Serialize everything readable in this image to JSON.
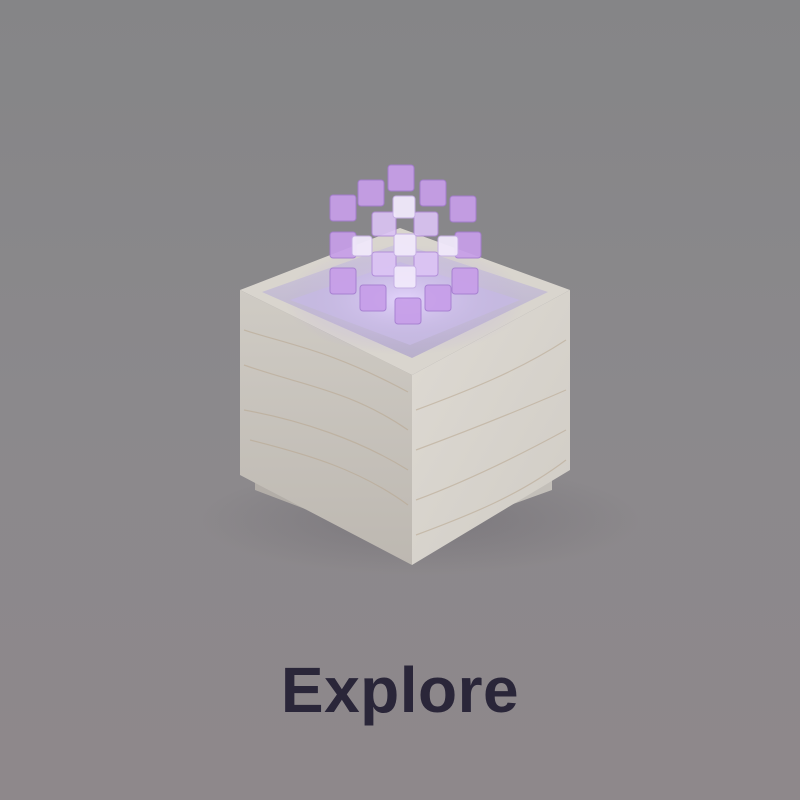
{
  "screen": {
    "label": "Explore",
    "colors": {
      "background_top": "#858587",
      "background_bottom": "#8e888b",
      "label_text": "#2a2639",
      "crystal_accent": "#c8a0ee",
      "box_face": "#d0cdc7"
    }
  },
  "illustration": {
    "icon": "crystal-cube-box-icon"
  }
}
